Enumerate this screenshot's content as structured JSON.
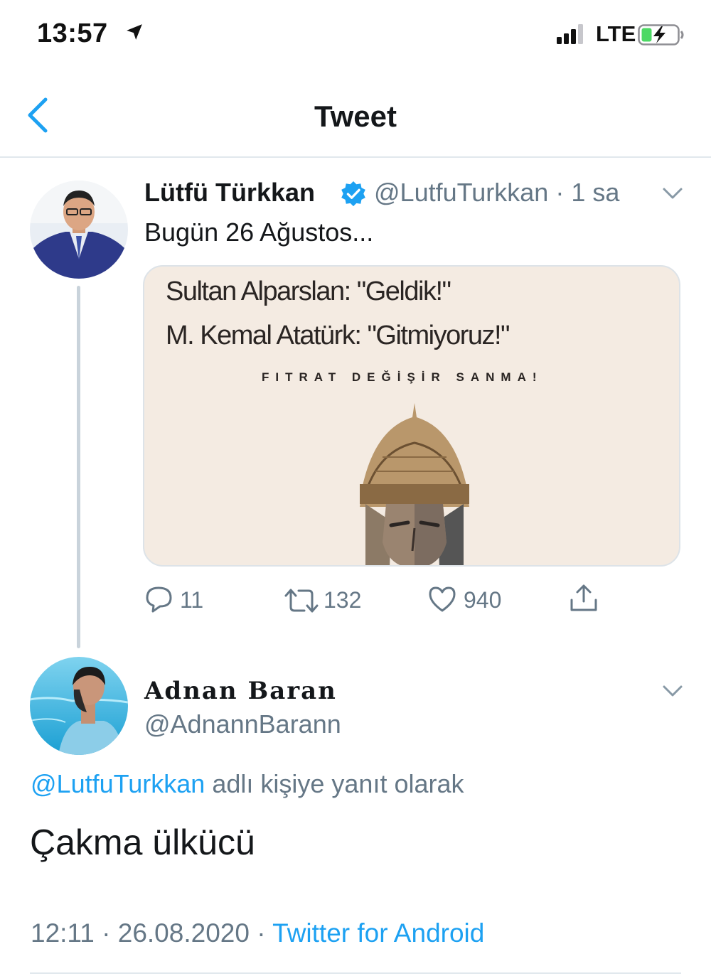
{
  "status_bar": {
    "time": "13:57",
    "network": "LTE",
    "battery_color": "#4cd964"
  },
  "nav": {
    "title": "Tweet",
    "accent_color": "#1da1f2"
  },
  "tweet": {
    "author_name": "Lütfü Türkkan",
    "verified": true,
    "handle": "@LutfuTurkkan",
    "time_ago": "1 sa",
    "text": "Bugün 26 Ağustos...",
    "image_text": {
      "line1": "Sultan Alparslan: \"Geldik!\"",
      "line2": "M. Kemal Atatürk: \"Gitmiyoruz!\"",
      "line3": "FITRAT DEĞİŞİR SANMA!"
    },
    "actions": {
      "replies": "11",
      "retweets": "132",
      "likes": "940"
    }
  },
  "reply": {
    "author_name": "Adnan Baran",
    "handle": "@AdnannBarann",
    "reply_to_handle": "@LutfuTurkkan",
    "reply_to_suffix": " adlı kişiye yanıt olarak",
    "text": "Çakma ülkücü",
    "time": "12:11",
    "date": "26.08.2020",
    "source": "Twitter for Android"
  }
}
